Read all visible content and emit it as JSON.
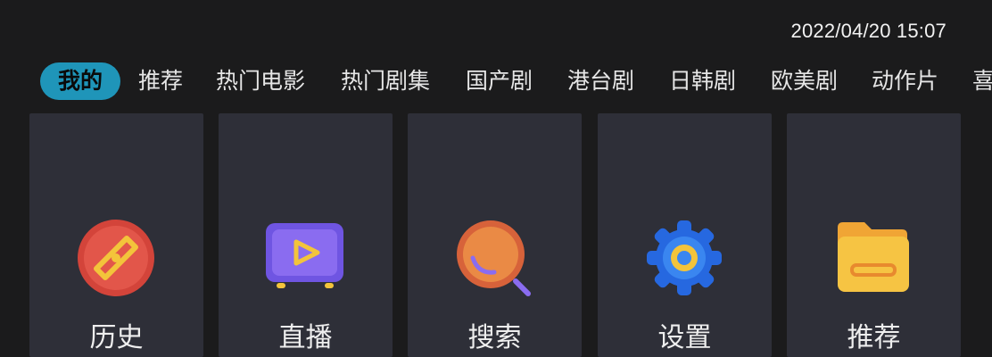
{
  "header": {
    "datetime": "2022/04/20 15:07"
  },
  "tabs": [
    {
      "label": "我的",
      "active": true
    },
    {
      "label": "推荐"
    },
    {
      "label": "热门电影"
    },
    {
      "label": "热门剧集"
    },
    {
      "label": "国产剧"
    },
    {
      "label": "港台剧"
    },
    {
      "label": "日韩剧"
    },
    {
      "label": "欧美剧"
    },
    {
      "label": "动作片"
    },
    {
      "label": "喜"
    }
  ],
  "cards": [
    {
      "label": "历史",
      "icon": "compass-icon",
      "color": "#d94a3c"
    },
    {
      "label": "直播",
      "icon": "tv-play-icon",
      "color": "#7b5fe6"
    },
    {
      "label": "搜索",
      "icon": "search-icon",
      "color": "#e27a3a"
    },
    {
      "label": "设置",
      "icon": "gear-icon",
      "color": "#2b73e3"
    },
    {
      "label": "推荐",
      "icon": "folder-icon",
      "color": "#f2b63a"
    }
  ],
  "colors": {
    "background": "#1b1b1c",
    "card": "#2e2f38",
    "active_tab": "#1f95b9",
    "accent_yellow": "#f3c43b"
  }
}
